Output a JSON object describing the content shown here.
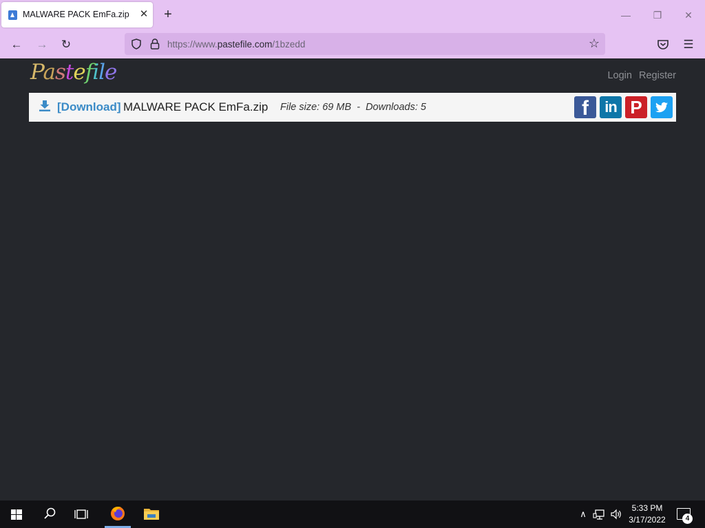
{
  "browser": {
    "tab": {
      "title": "MALWARE PACK EmFa.zip"
    },
    "url": {
      "prefix": "https://www.",
      "host": "pastefile.com",
      "path": "/1bzedd"
    }
  },
  "site": {
    "logo_letters": [
      "P",
      "a",
      "s",
      "t",
      "e",
      "f",
      "i",
      "l",
      "e"
    ],
    "nav": {
      "login": "Login",
      "register": "Register"
    }
  },
  "file": {
    "download_label": "[Download]",
    "name": "MALWARE PACK EmFa.zip",
    "info": "File size: 69 MB  -  Downloads: 5"
  },
  "social": {
    "facebook": "f",
    "linkedin": "in",
    "pinterest": "P"
  },
  "taskbar": {
    "time": "5:33 PM",
    "date": "3/17/2022",
    "notifications": "4"
  }
}
